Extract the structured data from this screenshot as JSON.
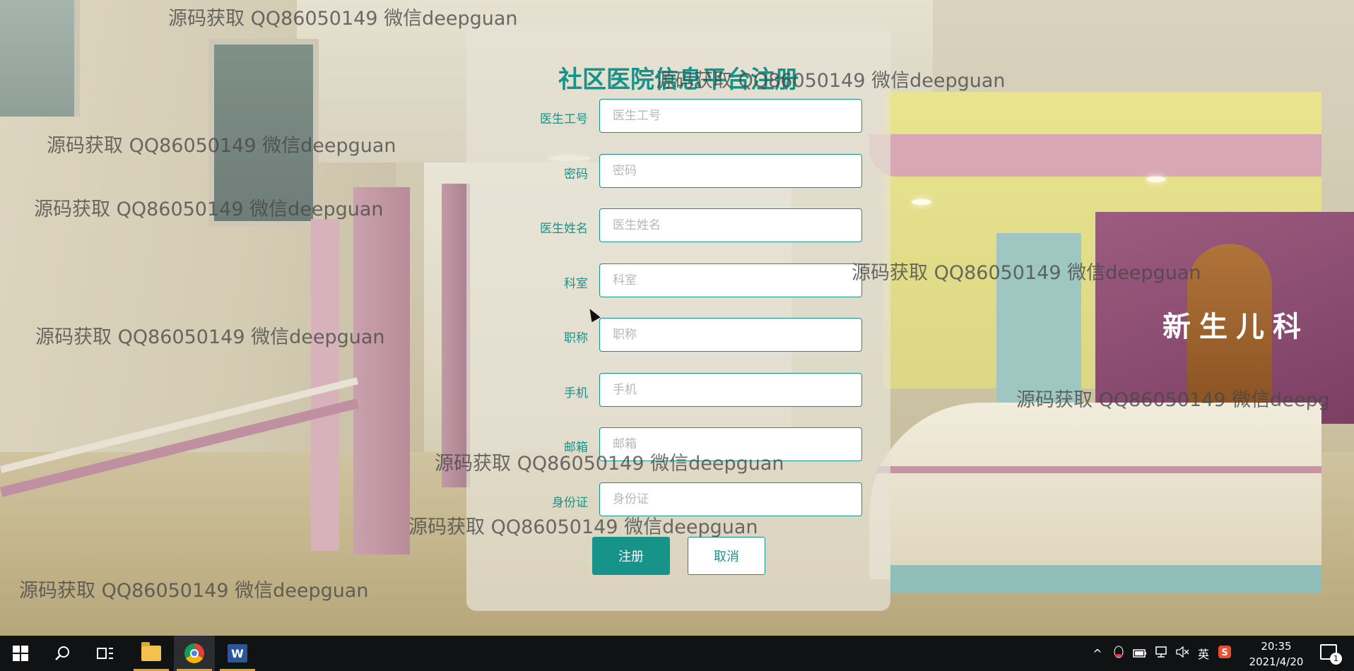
{
  "page": {
    "title": "社区医院信息平台注册"
  },
  "form": {
    "fields": [
      {
        "label": "医生工号",
        "placeholder": "医生工号",
        "value": ""
      },
      {
        "label": "密码",
        "placeholder": "密码",
        "value": ""
      },
      {
        "label": "医生姓名",
        "placeholder": "医生姓名",
        "value": ""
      },
      {
        "label": "科室",
        "placeholder": "科室",
        "value": ""
      },
      {
        "label": "职称",
        "placeholder": "职称",
        "value": ""
      },
      {
        "label": "手机",
        "placeholder": "手机",
        "value": ""
      },
      {
        "label": "邮箱",
        "placeholder": "邮箱",
        "value": ""
      },
      {
        "label": "身份证",
        "placeholder": "身份证",
        "value": ""
      }
    ],
    "submit_label": "注册",
    "cancel_label": "取消"
  },
  "background": {
    "mural_text": "新生儿科"
  },
  "watermark": "源码获取 QQ86050149 微信deepguan",
  "watermark_clipped": "源码获取 QQ86050149 微信deepg",
  "taskbar": {
    "ime_label": "英",
    "clock_time": "20:35",
    "clock_date": "2021/4/20",
    "notification_count": "1"
  },
  "colors": {
    "accent": "#16948a",
    "taskbar": "#101214"
  }
}
